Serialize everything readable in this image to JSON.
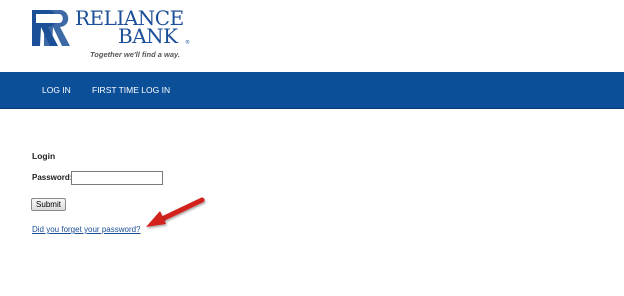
{
  "brand": {
    "name_line1": "RELIANCE",
    "name_line2": "BANK",
    "trademark": "®",
    "tagline": "Together we'll find a way.",
    "color": "#1b4f97",
    "icon": "reliance-rr-logo"
  },
  "nav": {
    "background": "#0b4f98",
    "items": [
      {
        "label": "LOG IN"
      },
      {
        "label": "FIRST TIME LOG IN"
      }
    ]
  },
  "login": {
    "title": "Login",
    "password_label": "Password:",
    "password_value": "",
    "submit_label": "Submit",
    "forgot_link": "Did you forget your password?"
  },
  "annotation": {
    "icon": "red-arrow",
    "color": "#d2201f"
  }
}
